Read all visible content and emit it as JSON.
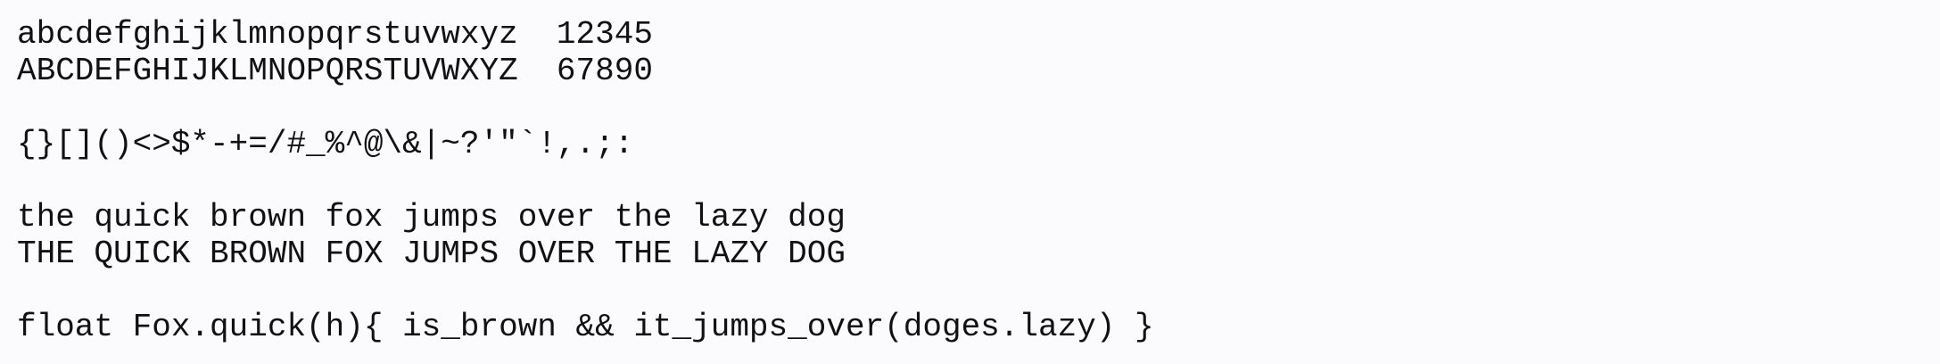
{
  "specimen": {
    "lowercase_alphabet": "abcdefghijklmnopqrstuvwxyz  12345",
    "uppercase_alphabet": "ABCDEFGHIJKLMNOPQRSTUVWXYZ  67890",
    "symbols": "{}[]()<>$*-+=/#_%^@\\&|~?'\"`!,.;:",
    "pangram_lower": "the quick brown fox jumps over the lazy dog",
    "pangram_upper": "THE QUICK BROWN FOX JUMPS OVER THE LAZY DOG",
    "code_sample": "float Fox.quick(h){ is_brown && it_jumps_over(doges.lazy) }"
  }
}
